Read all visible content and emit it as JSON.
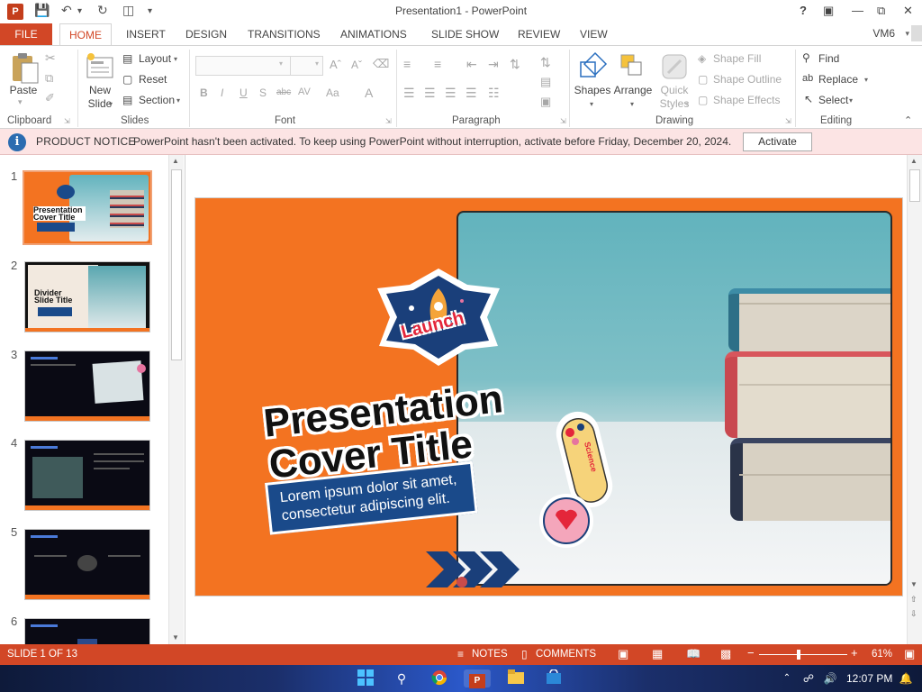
{
  "window": {
    "app_icon": "P",
    "title": "Presentation1 - PowerPoint",
    "help": "?",
    "user": "VM6"
  },
  "tabs": {
    "file": "FILE",
    "home": "HOME",
    "insert": "INSERT",
    "design": "DESIGN",
    "transitions": "TRANSITIONS",
    "animations": "ANIMATIONS",
    "slideshow": "SLIDE SHOW",
    "review": "REVIEW",
    "view": "VIEW"
  },
  "ribbon": {
    "clipboard": {
      "label": "Clipboard",
      "paste": "Paste"
    },
    "slides": {
      "label": "Slides",
      "new_slide_1": "New",
      "new_slide_2": "Slide",
      "layout": "Layout",
      "reset": "Reset",
      "section": "Section"
    },
    "font": {
      "label": "Font"
    },
    "paragraph": {
      "label": "Paragraph"
    },
    "drawing": {
      "label": "Drawing",
      "shapes": "Shapes",
      "arrange": "Arrange",
      "quick_styles_1": "Quick",
      "quick_styles_2": "Styles",
      "shape_fill": "Shape Fill",
      "shape_outline": "Shape Outline",
      "shape_effects": "Shape Effects"
    },
    "editing": {
      "label": "Editing",
      "find": "Find",
      "replace": "Replace",
      "select": "Select"
    }
  },
  "notice": {
    "title": "PRODUCT NOTICE",
    "message": "PowerPoint hasn't been activated. To keep using PowerPoint without interruption, activate before Friday, December 20, 2024.",
    "button": "Activate"
  },
  "thumbnails": {
    "numbers": [
      "1",
      "2",
      "3",
      "4",
      "5",
      "6"
    ],
    "t1_title": "Presentation Cover Title",
    "t2_title": "Divider Slide Title"
  },
  "slide": {
    "badge": "Launch",
    "title_line1": "Presentation",
    "title_line2": "Cover Title",
    "subtitle": "Lorem ipsum dolor sit amet, consectetur adipiscing elit.",
    "tube_label": "Science"
  },
  "status": {
    "slide_count": "SLIDE 1 OF 13",
    "notes": "NOTES",
    "comments": "COMMENTS",
    "zoom": "61%",
    "zoom_fraction": 0.45
  },
  "taskbar": {
    "time": "12:07 PM"
  },
  "colors": {
    "accent": "#d24726",
    "slide_bg": "#f37321",
    "navy": "#1a4a8a"
  }
}
